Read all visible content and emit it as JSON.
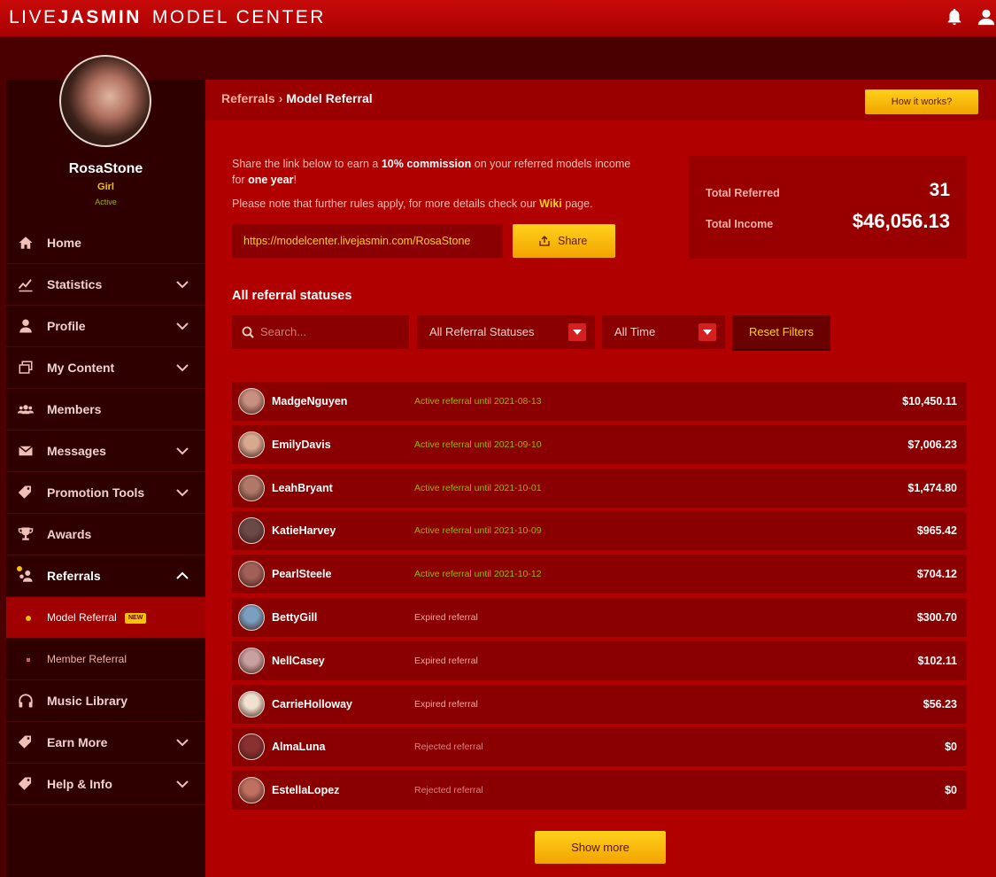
{
  "app": {
    "logo_part1": "LIVE",
    "logo_part2": "JASMIN",
    "logo_part3": "MODEL CENTER"
  },
  "profile": {
    "name": "RosaStone",
    "category": "Girl",
    "status": "Active"
  },
  "nav": {
    "home": "Home",
    "statistics": "Statistics",
    "profile": "Profile",
    "my_content": "My Content",
    "members": "Members",
    "messages": "Messages",
    "promotion_tools": "Promotion Tools",
    "awards": "Awards",
    "referrals": "Referrals",
    "model_referral": "Model Referral",
    "new_badge": "NEW",
    "member_referral": "Member Referral",
    "music_library": "Music Library",
    "earn_more": "Earn More",
    "help_info": "Help & Info"
  },
  "breadcrumb": {
    "parent": "Referrals",
    "separator": "›",
    "current": "Model Referral"
  },
  "how_it_works": "How it works?",
  "intro": {
    "p1_a": "Share the link below to earn a ",
    "p1_b": "10% commission",
    "p1_c": " on your referred models income for ",
    "p1_d": "one year",
    "p1_e": "!",
    "p2_a": "Please note that further rules apply, for more details check our ",
    "p2_b": "Wiki",
    "p2_c": " page."
  },
  "referral_link": "https://modelcenter.livejasmin.com/RosaStone",
  "share_label": "Share",
  "totals": {
    "referred_label": "Total Referred",
    "referred_value": "31",
    "income_label": "Total Income",
    "income_value": "$46,056.13"
  },
  "section_title": "All referral statuses",
  "filters": {
    "search_placeholder": "Search...",
    "status": "All Referral Statuses",
    "time": "All Time",
    "reset": "Reset Filters"
  },
  "status_colors": {
    "active": "#9fb000",
    "expired": "#f0a898",
    "rejected": "#e08080"
  },
  "referrals": [
    {
      "name": "MadgeNguyen",
      "status": "Active referral until 2021-08-13",
      "kind": "active",
      "amount": "$10,450.11"
    },
    {
      "name": "EmilyDavis",
      "status": "Active referral until 2021-09-10",
      "kind": "active",
      "amount": "$7,006.23"
    },
    {
      "name": "LeahBryant",
      "status": "Active referral until 2021-10-01",
      "kind": "active",
      "amount": "$1,474.80"
    },
    {
      "name": "KatieHarvey",
      "status": "Active referral until 2021-10-09",
      "kind": "active",
      "amount": "$965.42"
    },
    {
      "name": "PearlSteele",
      "status": "Active referral until 2021-10-12",
      "kind": "active",
      "amount": "$704.12"
    },
    {
      "name": "BettyGill",
      "status": "Expired referral",
      "kind": "expired",
      "amount": "$300.70"
    },
    {
      "name": "NellCasey",
      "status": "Expired referral",
      "kind": "expired",
      "amount": "$102.11"
    },
    {
      "name": "CarrieHolloway",
      "status": "Expired referral",
      "kind": "expired",
      "amount": "$56.23"
    },
    {
      "name": "AlmaLuna",
      "status": "Rejected referral",
      "kind": "rejected",
      "amount": "$0"
    },
    {
      "name": "EstellaLopez",
      "status": "Rejected referral",
      "kind": "rejected",
      "amount": "$0"
    }
  ],
  "show_more": "Show more"
}
